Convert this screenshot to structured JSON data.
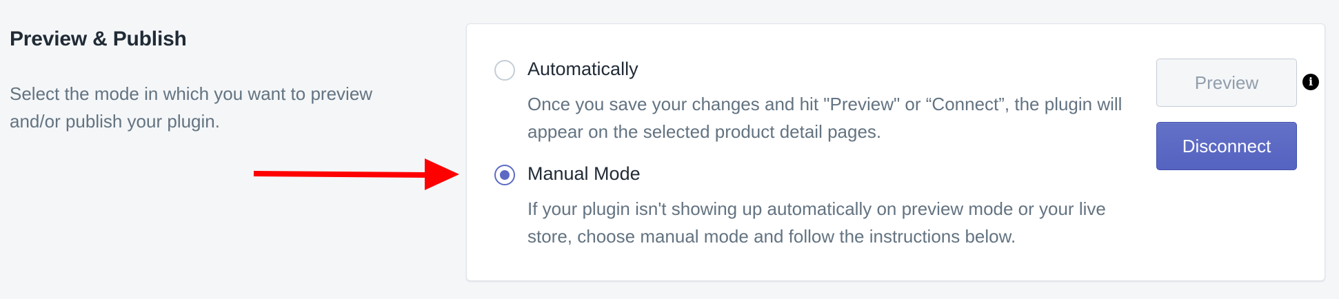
{
  "section": {
    "title": "Preview & Publish",
    "description": "Select the mode in which you want to preview and/or publish your plugin."
  },
  "options": [
    {
      "label": "Automatically",
      "help": "Once you save your changes and hit \"Preview\" or “Connect”, the plugin will appear on the selected product detail pages.",
      "checked": false
    },
    {
      "label": "Manual Mode",
      "help": "If your plugin isn't showing up automatically on preview mode or your live store, choose manual mode and follow the instructions below.",
      "checked": true
    }
  ],
  "buttons": {
    "preview_label": "Preview",
    "disconnect_label": "Disconnect"
  },
  "icons": {
    "info": "info-icon",
    "annotation": "red-arrow-icon"
  },
  "colors": {
    "accent": "#5c6ac4",
    "arrow": "#ff0000",
    "background": "#f4f6f8"
  }
}
